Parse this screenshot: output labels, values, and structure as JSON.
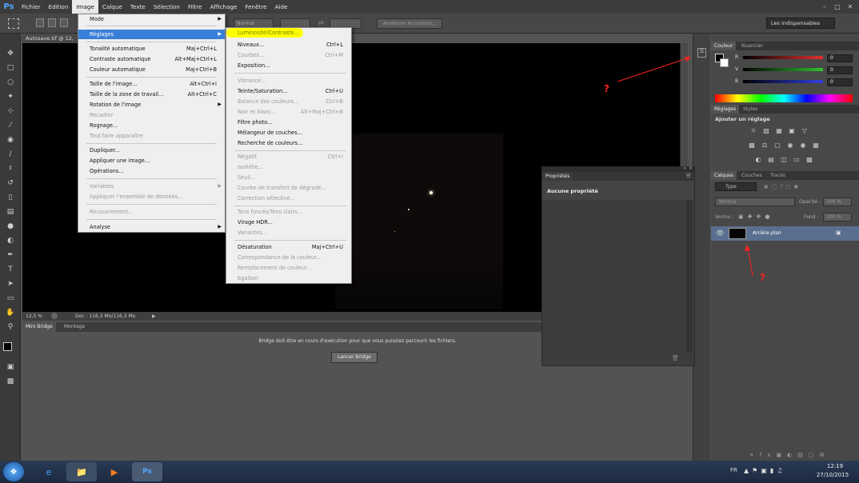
{
  "app": {
    "logo": "Ps"
  },
  "menubar": {
    "items": [
      "Fichier",
      "Edition",
      "Image",
      "Calque",
      "Texte",
      "Sélection",
      "Filtre",
      "Affichage",
      "Fenêtre",
      "Aide"
    ]
  },
  "options_bar": {
    "mode": "Normal",
    "refine_edge": "Améliorer le contour...",
    "workspace": "Les indispensables"
  },
  "document": {
    "tab_title": "Autosave.tif @ 12,",
    "zoom": "12,5 %",
    "doc_info": "Doc : 116,3 Mo/116,3 Mo"
  },
  "image_menu": {
    "items": [
      {
        "label": "Mode",
        "shortcut": "",
        "arrow": true,
        "disabled": false
      },
      {
        "label": "Réglages",
        "shortcut": "",
        "arrow": true,
        "disabled": false,
        "highlighted": true
      },
      {
        "label": "Tonalité automatique",
        "shortcut": "Maj+Ctrl+L",
        "disabled": false
      },
      {
        "label": "Contraste automatique",
        "shortcut": "Alt+Maj+Ctrl+L",
        "disabled": false
      },
      {
        "label": "Couleur automatique",
        "shortcut": "Maj+Ctrl+B",
        "disabled": false
      },
      {
        "label": "Taille de l'image...",
        "shortcut": "Alt+Ctrl+I",
        "disabled": false
      },
      {
        "label": "Taille de la zone de travail...",
        "shortcut": "Alt+Ctrl+C",
        "disabled": false
      },
      {
        "label": "Rotation de l'image",
        "shortcut": "",
        "arrow": true,
        "disabled": false
      },
      {
        "label": "Recadrer",
        "shortcut": "",
        "disabled": true
      },
      {
        "label": "Rognage...",
        "shortcut": "",
        "disabled": false
      },
      {
        "label": "Tout faire apparaître",
        "shortcut": "",
        "disabled": true
      },
      {
        "label": "Dupliquer...",
        "shortcut": "",
        "disabled": false
      },
      {
        "label": "Appliquer une image...",
        "shortcut": "",
        "disabled": false
      },
      {
        "label": "Opérations...",
        "shortcut": "",
        "disabled": false
      },
      {
        "label": "Variables",
        "shortcut": "",
        "arrow": true,
        "disabled": true
      },
      {
        "label": "Appliquer l'ensemble de données...",
        "shortcut": "",
        "disabled": true
      },
      {
        "label": "Recouvrement...",
        "shortcut": "",
        "disabled": true
      },
      {
        "label": "Analyse",
        "shortcut": "",
        "arrow": true,
        "disabled": false
      }
    ]
  },
  "reglages_menu": {
    "items": [
      {
        "label": "Luminosité/Contraste...",
        "shortcut": "",
        "disabled": false,
        "annotated": true
      },
      {
        "label": "Niveaux...",
        "shortcut": "Ctrl+L",
        "disabled": false
      },
      {
        "label": "Courbes...",
        "shortcut": "Ctrl+M",
        "disabled": true
      },
      {
        "label": "Exposition...",
        "shortcut": "",
        "disabled": false
      },
      {
        "label": "Vibrance...",
        "shortcut": "",
        "disabled": true
      },
      {
        "label": "Teinte/Saturation...",
        "shortcut": "Ctrl+U",
        "disabled": false
      },
      {
        "label": "Balance des couleurs...",
        "shortcut": "Ctrl+B",
        "disabled": true
      },
      {
        "label": "Noir et blanc...",
        "shortcut": "Alt+Maj+Ctrl+B",
        "disabled": true
      },
      {
        "label": "Filtre photo...",
        "shortcut": "",
        "disabled": false
      },
      {
        "label": "Mélangeur de couches...",
        "shortcut": "",
        "disabled": false
      },
      {
        "label": "Recherche de couleurs...",
        "shortcut": "",
        "disabled": false
      },
      {
        "label": "Négatif",
        "shortcut": "Ctrl+I",
        "disabled": true
      },
      {
        "label": "Isohélie...",
        "shortcut": "",
        "disabled": true
      },
      {
        "label": "Seuil...",
        "shortcut": "",
        "disabled": true
      },
      {
        "label": "Courbe de transfert de dégradé...",
        "shortcut": "",
        "disabled": true
      },
      {
        "label": "Correction sélective...",
        "shortcut": "",
        "disabled": true
      },
      {
        "label": "Tons foncés/Tons clairs...",
        "shortcut": "",
        "disabled": true
      },
      {
        "label": "Virage HDR...",
        "shortcut": "",
        "disabled": false
      },
      {
        "label": "Variantes...",
        "shortcut": "",
        "disabled": true
      },
      {
        "label": "Désaturation",
        "shortcut": "Maj+Ctrl+U",
        "disabled": false
      },
      {
        "label": "Correspondance de la couleur...",
        "shortcut": "",
        "disabled": true
      },
      {
        "label": "Remplacement de couleur...",
        "shortcut": "",
        "disabled": true
      },
      {
        "label": "Egaliser",
        "shortcut": "",
        "disabled": true
      }
    ]
  },
  "properties_panel": {
    "tab": "Propriétés",
    "message": "Aucune propriété"
  },
  "bridge": {
    "tabs": [
      "Mini Bridge",
      "Montage"
    ],
    "message": "Bridge doit être en cours d'exécution pour que vous puissiez parcourir les fichiers.",
    "launch_button": "Lancer Bridge"
  },
  "color_panel": {
    "tabs": [
      "Couleur",
      "Nuancier"
    ],
    "channels": [
      {
        "label": "R",
        "value": "0",
        "color": "#e03030"
      },
      {
        "label": "V",
        "value": "0",
        "color": "#30c030"
      },
      {
        "label": "B",
        "value": "0",
        "color": "#3040e0"
      }
    ]
  },
  "adjustments_panel": {
    "tabs": [
      "Réglages",
      "Styles"
    ],
    "title": "Ajouter un réglage"
  },
  "layers_panel": {
    "tabs": [
      "Calques",
      "Couches",
      "Tracés"
    ],
    "filter": "Type",
    "blend_mode": "Normal",
    "opacity_label": "Opacité :",
    "opacity_value": "100 %",
    "lock_label": "Verrou :",
    "fill_label": "Fond :",
    "fill_value": "100 %",
    "layer_name": "Arrière-plan"
  },
  "annotations": {
    "question_mark": "?"
  },
  "taskbar": {
    "lang": "FR",
    "time": "12:19",
    "date": "27/10/2015"
  },
  "colors": {
    "highlight_annotation": "#ffff00",
    "menu_highlight": "#3a7fd7",
    "annotation_red": "#ff2020"
  }
}
